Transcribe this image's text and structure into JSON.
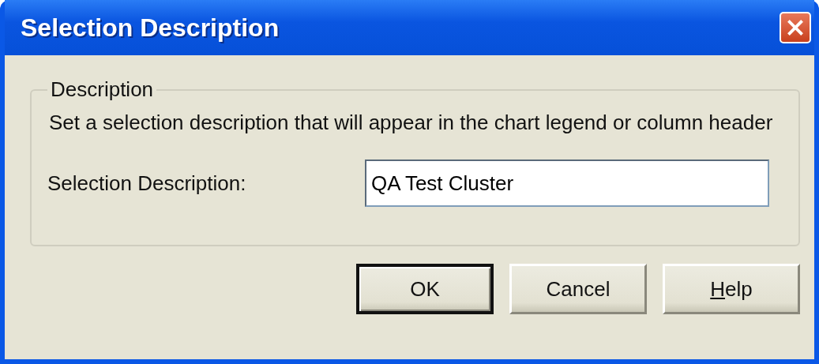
{
  "window": {
    "title": "Selection Description"
  },
  "group": {
    "legend": "Description",
    "text": "Set a selection description that will appear in the chart legend or column header",
    "field": {
      "label": "Selection Description:",
      "value": "QA Test Cluster"
    }
  },
  "buttons": [
    {
      "label": "OK",
      "default": true,
      "underline_first": false
    },
    {
      "label": "Cancel",
      "default": false,
      "underline_first": false
    },
    {
      "label": "Help",
      "default": false,
      "underline_first": true
    }
  ]
}
